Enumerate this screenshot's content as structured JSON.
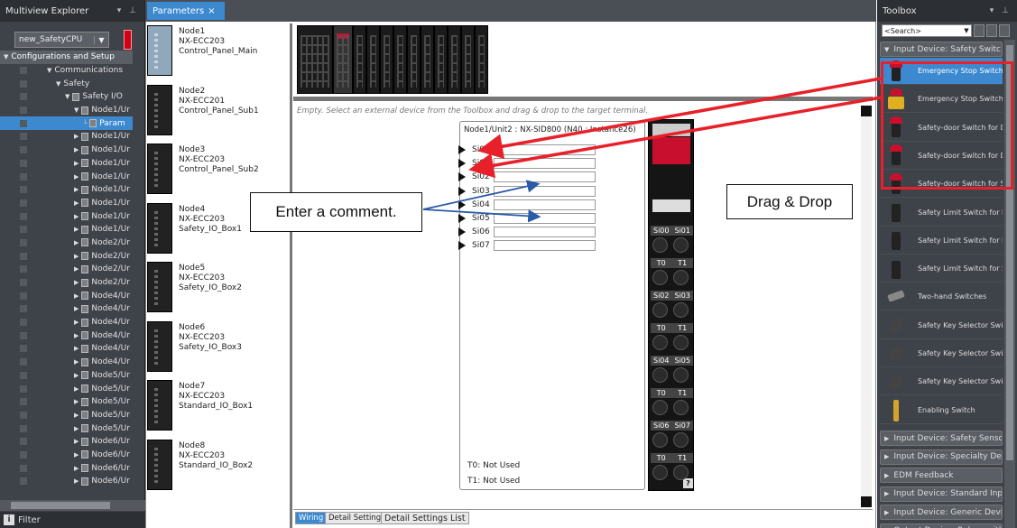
{
  "explorer": {
    "title": "Multiview Explorer",
    "pin": "▾ ⊥",
    "cpu_select": "new_SafetyCPU",
    "filter": "Filter",
    "tree": [
      {
        "label": "Configurations and Setup",
        "indent": 0,
        "tw": "▼",
        "style": "sec"
      },
      {
        "label": "Communications",
        "indent": 3,
        "tw": "▼"
      },
      {
        "label": "Safety",
        "indent": 4,
        "tw": "▼"
      },
      {
        "label": "Safety I/O",
        "indent": 5,
        "tw": "▼"
      },
      {
        "label": "Node1/Ur",
        "indent": 6,
        "tw": "▼"
      },
      {
        "label": "Param",
        "indent": 7,
        "tw": "└",
        "style": "sel"
      },
      {
        "label": "Node1/Ur",
        "indent": 6,
        "tw": "▶"
      },
      {
        "label": "Node1/Ur",
        "indent": 6,
        "tw": "▶"
      },
      {
        "label": "Node1/Ur",
        "indent": 6,
        "tw": "▶"
      },
      {
        "label": "Node1/Ur",
        "indent": 6,
        "tw": "▶"
      },
      {
        "label": "Node1/Ur",
        "indent": 6,
        "tw": "▶"
      },
      {
        "label": "Node1/Ur",
        "indent": 6,
        "tw": "▶"
      },
      {
        "label": "Node1/Ur",
        "indent": 6,
        "tw": "▶"
      },
      {
        "label": "Node1/Ur",
        "indent": 6,
        "tw": "▶"
      },
      {
        "label": "Node2/Ur",
        "indent": 6,
        "tw": "▶"
      },
      {
        "label": "Node2/Ur",
        "indent": 6,
        "tw": "▶"
      },
      {
        "label": "Node2/Ur",
        "indent": 6,
        "tw": "▶"
      },
      {
        "label": "Node2/Ur",
        "indent": 6,
        "tw": "▶"
      },
      {
        "label": "Node4/Ur",
        "indent": 6,
        "tw": "▶"
      },
      {
        "label": "Node4/Ur",
        "indent": 6,
        "tw": "▶"
      },
      {
        "label": "Node4/Ur",
        "indent": 6,
        "tw": "▶"
      },
      {
        "label": "Node4/Ur",
        "indent": 6,
        "tw": "▶"
      },
      {
        "label": "Node4/Ur",
        "indent": 6,
        "tw": "▶"
      },
      {
        "label": "Node4/Ur",
        "indent": 6,
        "tw": "▶"
      },
      {
        "label": "Node5/Ur",
        "indent": 6,
        "tw": "▶"
      },
      {
        "label": "Node5/Ur",
        "indent": 6,
        "tw": "▶"
      },
      {
        "label": "Node5/Ur",
        "indent": 6,
        "tw": "▶"
      },
      {
        "label": "Node5/Ur",
        "indent": 6,
        "tw": "▶"
      },
      {
        "label": "Node5/Ur",
        "indent": 6,
        "tw": "▶"
      },
      {
        "label": "Node6/Ur",
        "indent": 6,
        "tw": "▶"
      },
      {
        "label": "Node6/Ur",
        "indent": 6,
        "tw": "▶"
      },
      {
        "label": "Node6/Ur",
        "indent": 6,
        "tw": "▶"
      },
      {
        "label": "Node6/Ur",
        "indent": 6,
        "tw": "▶"
      }
    ]
  },
  "editor": {
    "tab_label": "Parameters",
    "tab_close": "×",
    "empty_hint": "Empty. Select an external device from the Toolbox and drag & drop to the target terminal.",
    "nodes": [
      {
        "name": "Node1",
        "model": "NX-ECC203",
        "label": "Control_Panel_Main",
        "blue": true
      },
      {
        "name": "Node2",
        "model": "NX-ECC201",
        "label": "Control_Panel_Sub1"
      },
      {
        "name": "Node3",
        "model": "NX-ECC203",
        "label": "Control_Panel_Sub2"
      },
      {
        "name": "Node4",
        "model": "NX-ECC203",
        "label": "Safety_IO_Box1"
      },
      {
        "name": "Node5",
        "model": "NX-ECC203",
        "label": "Safety_IO_Box2"
      },
      {
        "name": "Node6",
        "model": "NX-ECC203",
        "label": "Safety_IO_Box3"
      },
      {
        "name": "Node7",
        "model": "NX-ECC203",
        "label": "Standard_IO_Box1"
      },
      {
        "name": "Node8",
        "model": "NX-ECC203",
        "label": "Standard_IO_Box2"
      }
    ],
    "unit_title": "Node1/Unit2 : NX-SID800 (N40 : Instance26)",
    "terminals": [
      "Si00",
      "Si01",
      "Si02",
      "Si03",
      "Si04",
      "Si05",
      "Si06",
      "Si07"
    ],
    "t0_status": "T0: Not Used",
    "t1_status": "T1: Not Used",
    "block_labels": [
      [
        "Si00",
        "Si01"
      ],
      [
        "T0",
        "T1"
      ],
      [
        "Si02",
        "Si03"
      ],
      [
        "T0",
        "T1"
      ],
      [
        "Si04",
        "Si05"
      ],
      [
        "T0",
        "T1"
      ],
      [
        "Si06",
        "Si07"
      ],
      [
        "T0",
        "T1"
      ]
    ],
    "help": "?",
    "bottom_tabs": [
      "Wiring",
      "Detail Settings",
      "Detail Settings List"
    ]
  },
  "toolbox": {
    "title": "Toolbox",
    "pin": "▾ ⊥",
    "search_placeholder": "<Search>",
    "categories_top": {
      "label": "Input Device: Safety Switc",
      "expanded": true
    },
    "items": [
      {
        "label": "Emergency Stop Switch f",
        "icon": "emergency-stop-icon",
        "selected": true
      },
      {
        "label": "Emergency Stop Switch f",
        "icon": "emergency-stop-box-icon"
      },
      {
        "label": "Safety-door Switch for Do",
        "icon": "door-switch-icon"
      },
      {
        "label": "Safety-door Switch for Do",
        "icon": "door-switch-icon"
      },
      {
        "label": "Safety-door Switch for Sli",
        "icon": "door-switch-icon"
      },
      {
        "label": "Safety Limit Switch for Do",
        "icon": "limit-switch-icon"
      },
      {
        "label": "Safety Limit Switch for Do",
        "icon": "limit-switch-icon"
      },
      {
        "label": "Safety Limit Switch for Sli",
        "icon": "limit-switch-icon"
      },
      {
        "label": "Two-hand Switches",
        "icon": "two-hand-switch-icon"
      },
      {
        "label": "Safety Key Selector Switc",
        "icon": "key-selector-icon"
      },
      {
        "label": "Safety Key Selector Switc",
        "icon": "key-selector-icon"
      },
      {
        "label": "Safety Key Selector Switc",
        "icon": "key-selector-icon"
      },
      {
        "label": "Enabling Switch",
        "icon": "enabling-switch-icon"
      }
    ],
    "categories": [
      "Input Device: Safety Senso",
      "Input Device: Specialty De",
      "EDM Feedback",
      "Input Device: Standard Inp",
      "Input Device: Generic Devi",
      "Output Device: Relays with"
    ]
  },
  "annotations": {
    "comment_callout": "Enter a comment.",
    "drag_callout": "Drag & Drop",
    "red": "#e8202a",
    "blue": "#2a5aa8"
  }
}
